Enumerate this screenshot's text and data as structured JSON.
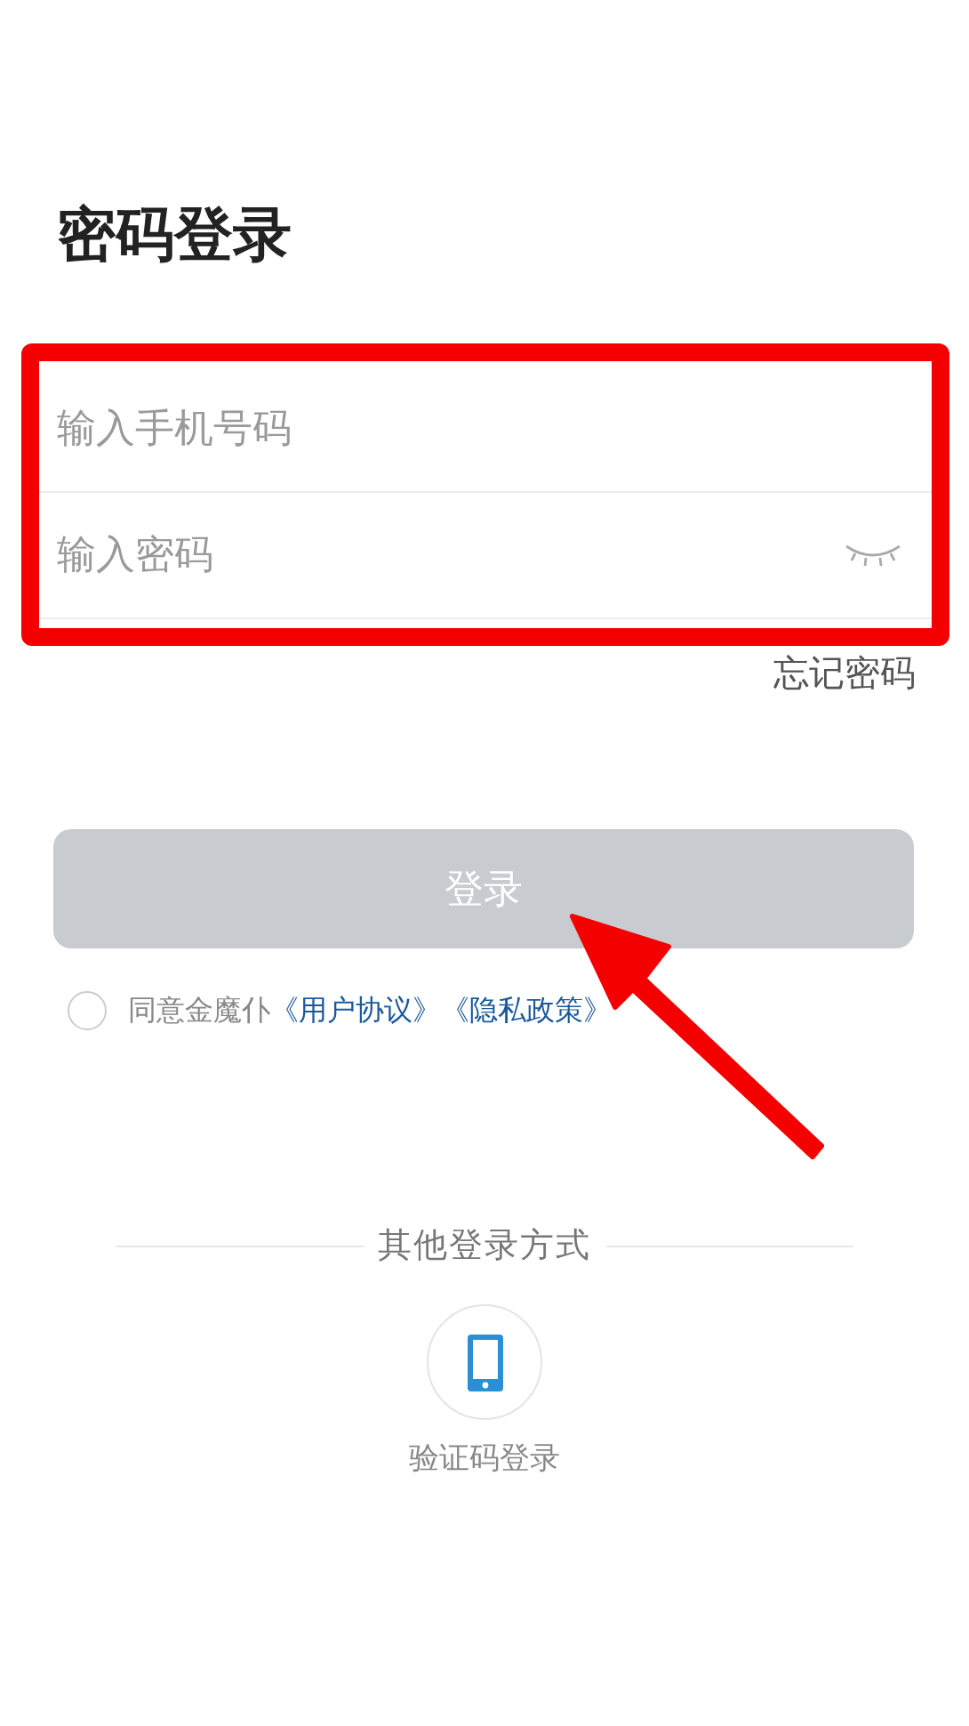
{
  "title": "密码登录",
  "fields": [
    {
      "placeholder": "输入手机号码",
      "kind": "phone"
    },
    {
      "placeholder": "输入密码",
      "kind": "password"
    }
  ],
  "forgot_link": "忘记密码",
  "login_button": {
    "label": "登录",
    "disabled": true
  },
  "agreement": {
    "checked": false,
    "text": "同意金魔仆",
    "links": [
      "《用户协议》",
      "《隐私政策》"
    ]
  },
  "other_login": {
    "heading": "其他登录方式",
    "options": [
      {
        "label": "验证码登录",
        "kind": "sms"
      }
    ]
  },
  "annotation": {
    "highlight": true,
    "arrow": true
  }
}
